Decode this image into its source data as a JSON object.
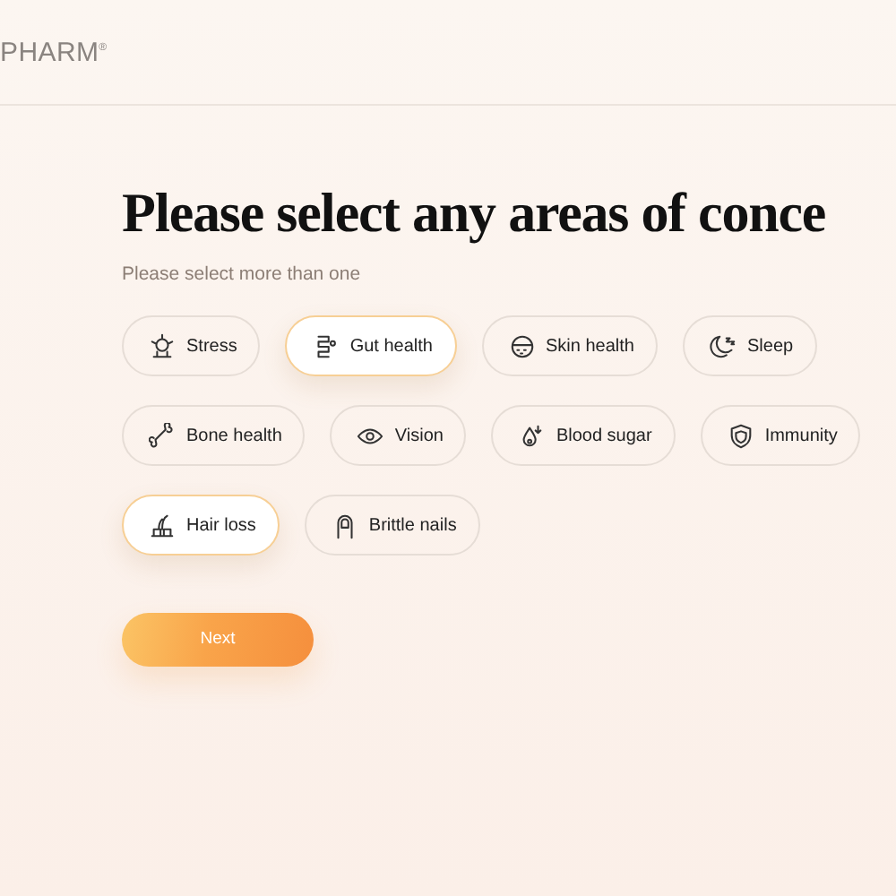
{
  "header": {
    "logo": "PHARM$^{®}$"
  },
  "title": "Please select any areas of conce",
  "subtitle": "Please select more than one",
  "concerns": [
    {
      "label": "Stress",
      "selected": false
    },
    {
      "label": "Gut health",
      "selected": true
    },
    {
      "label": "Skin health",
      "selected": false
    },
    {
      "label": "Sleep",
      "selected": false
    },
    {
      "label": "Bone health",
      "selected": false
    },
    {
      "label": "Vision",
      "selected": false
    },
    {
      "label": "Blood sugar",
      "selected": false
    },
    {
      "label": "Immunity",
      "selected": false
    },
    {
      "label": "Hair loss",
      "selected": true
    },
    {
      "label": "Brittle nails",
      "selected": false
    }
  ],
  "next_button": "Next"
}
